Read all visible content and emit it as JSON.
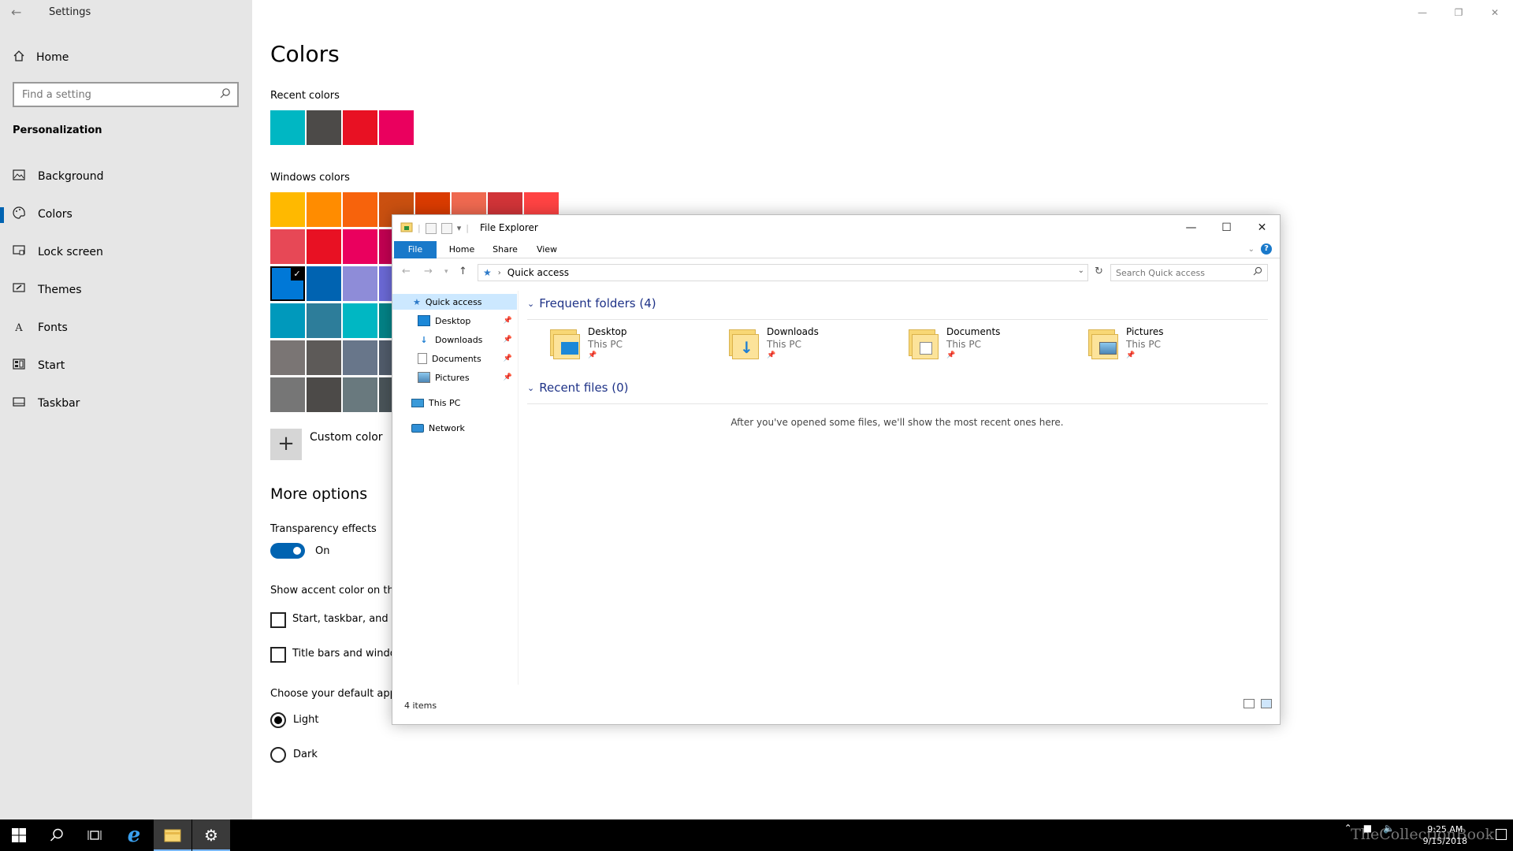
{
  "settings": {
    "title": "Settings",
    "home_label": "Home",
    "search_placeholder": "Find a setting",
    "section": "Personalization",
    "nav": [
      {
        "label": "Background",
        "icon": "image-icon"
      },
      {
        "label": "Colors",
        "icon": "palette-icon",
        "active": true
      },
      {
        "label": "Lock screen",
        "icon": "lockscreen-icon"
      },
      {
        "label": "Themes",
        "icon": "brush-icon"
      },
      {
        "label": "Fonts",
        "icon": "font-icon"
      },
      {
        "label": "Start",
        "icon": "start-icon"
      },
      {
        "label": "Taskbar",
        "icon": "taskbar-icon"
      }
    ],
    "heading": "Colors",
    "recent_label": "Recent colors",
    "recent_colors": [
      "#00b7c3",
      "#4c4a48",
      "#e81123",
      "#ea005e"
    ],
    "windows_label": "Windows colors",
    "windows_colors": [
      [
        "#ffb900",
        "#ff8c00",
        "#f7630c",
        "#ca5010",
        "#da3b01",
        "#ef6950",
        "#d13438",
        "#ff4343"
      ],
      [
        "#e74856",
        "#e81123",
        "#ea005e",
        "#c30052"
      ],
      [
        "#0078d7",
        "#0063b1",
        "#8e8cd8",
        "#6b69d6"
      ],
      [
        "#0099bc",
        "#2d7d9a",
        "#00b7c3",
        "#038387"
      ],
      [
        "#7a7574",
        "#5d5a58",
        "#68768a",
        "#515c6b"
      ],
      [
        "#767676",
        "#4c4a48",
        "#69797e",
        "#4a5459"
      ]
    ],
    "selected_color": "#0078d7",
    "custom_color_label": "Custom color",
    "more_options": "More options",
    "transparency_label": "Transparency effects",
    "transparency_state": "On",
    "accent_show_label": "Show accent color on the",
    "accent_start_label": "Start, taskbar, and ac",
    "accent_title_label": "Title bars and windo",
    "app_mode_label": "Choose your default app",
    "mode_light": "Light",
    "mode_dark": "Dark"
  },
  "explorer": {
    "title": "File Explorer",
    "tabs": [
      "File",
      "Home",
      "Share",
      "View"
    ],
    "address": "Quick access",
    "search_placeholder": "Search Quick access",
    "nav": {
      "quick_access": "Quick access",
      "pinned": [
        "Desktop",
        "Downloads",
        "Documents",
        "Pictures"
      ],
      "this_pc": "This PC",
      "network": "Network"
    },
    "frequent_header": "Frequent folders (4)",
    "folders": [
      {
        "name": "Desktop",
        "location": "This PC"
      },
      {
        "name": "Downloads",
        "location": "This PC"
      },
      {
        "name": "Documents",
        "location": "This PC"
      },
      {
        "name": "Pictures",
        "location": "This PC"
      }
    ],
    "recent_header": "Recent files (0)",
    "empty_message": "After you've opened some files, we'll show the most recent ones here.",
    "status": "4 items"
  },
  "taskbar": {
    "clock_time": "9:25 AM",
    "clock_date": "9/15/2018",
    "watermark": "TheCollectionBook"
  }
}
